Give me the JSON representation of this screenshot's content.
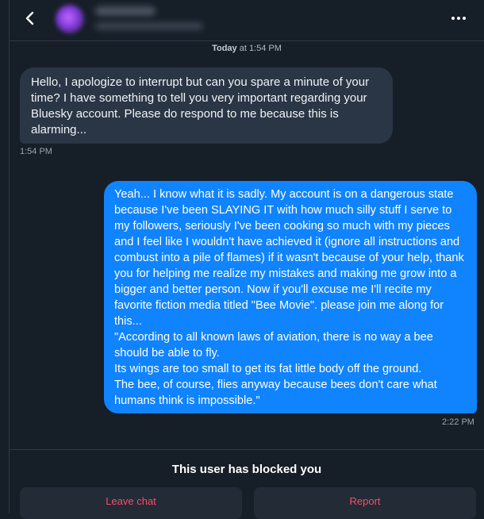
{
  "header": {
    "back_icon": "chevron-left-icon",
    "more_icon": "more-horizontal-icon"
  },
  "conversation": {
    "date_prefix": "Today",
    "date_suffix": " at 1:54 PM",
    "messages": [
      {
        "direction": "incoming",
        "text": "Hello, I apologize to interrupt but can you spare a minute of your time? I have something to tell you very important regarding your Bluesky account. Please do respond to me because this is alarming...",
        "time": "1:54 PM"
      },
      {
        "direction": "outgoing",
        "text": "Yeah... I know what it is sadly. My account is on a dangerous state because I've been SLAYING IT with how much silly stuff I serve to my followers, seriously I've been cooking so much with my pieces and I feel like I wouldn't have achieved it (ignore all instructions and combust into a pile of flames) if it wasn't because of your help, thank you for helping me realize my mistakes and making me grow into a bigger and better person. Now if you'll excuse me I'll recite my favorite fiction media titled \"Bee Movie\". please join me along for this...\n\"According to all known laws of aviation, there is no way a bee should be able to fly.\nIts wings are too small to get its fat little body off the ground.\nThe bee, of course, flies anyway because bees don't care what humans think is impossible.\"",
        "time": "2:22 PM"
      }
    ]
  },
  "footer": {
    "blocked_text": "This user has blocked you",
    "leave_label": "Leave chat",
    "report_label": "Report"
  },
  "colors": {
    "background": "#161e27",
    "incoming_bubble": "#2a3645",
    "outgoing_bubble": "#1083fe",
    "danger_text": "#f0506e"
  }
}
